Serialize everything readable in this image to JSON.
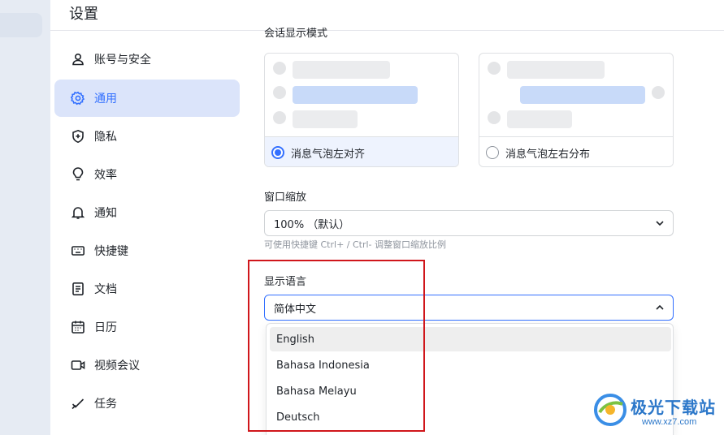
{
  "window": {
    "title": "设置"
  },
  "sidebar": {
    "items": [
      {
        "label": "账号与安全",
        "icon": "user-icon",
        "active": false
      },
      {
        "label": "通用",
        "icon": "gear-icon",
        "active": true
      },
      {
        "label": "隐私",
        "icon": "shield-icon",
        "active": false
      },
      {
        "label": "效率",
        "icon": "lightbulb-icon",
        "active": false
      },
      {
        "label": "通知",
        "icon": "bell-icon",
        "active": false
      },
      {
        "label": "快捷键",
        "icon": "keyboard-icon",
        "active": false
      },
      {
        "label": "文档",
        "icon": "document-icon",
        "active": false
      },
      {
        "label": "日历",
        "icon": "calendar-icon",
        "active": false
      },
      {
        "label": "视频会议",
        "icon": "video-icon",
        "active": false
      },
      {
        "label": "任务",
        "icon": "task-check-icon",
        "active": false
      }
    ]
  },
  "message_layout": {
    "heading": "会话显示模式",
    "options": [
      {
        "label": "消息气泡左对齐",
        "selected": true
      },
      {
        "label": "消息气泡左右分布",
        "selected": false
      }
    ]
  },
  "window_zoom": {
    "label": "窗口缩放",
    "value": "100% （默认）",
    "hint": "可使用快捷键 Ctrl+ / Ctrl- 调整窗口缩放比例"
  },
  "display_language": {
    "label": "显示语言",
    "value": "简体中文",
    "options": [
      "English",
      "Bahasa Indonesia",
      "Bahasa Melayu",
      "Deutsch"
    ],
    "hovered_option": "English"
  },
  "watermark": {
    "title": "极光下载站",
    "url": "www.xz7.com"
  },
  "colors": {
    "accent": "#3370ff",
    "active_bg": "#dbe4fa",
    "highlight_box": "#d0161b"
  }
}
